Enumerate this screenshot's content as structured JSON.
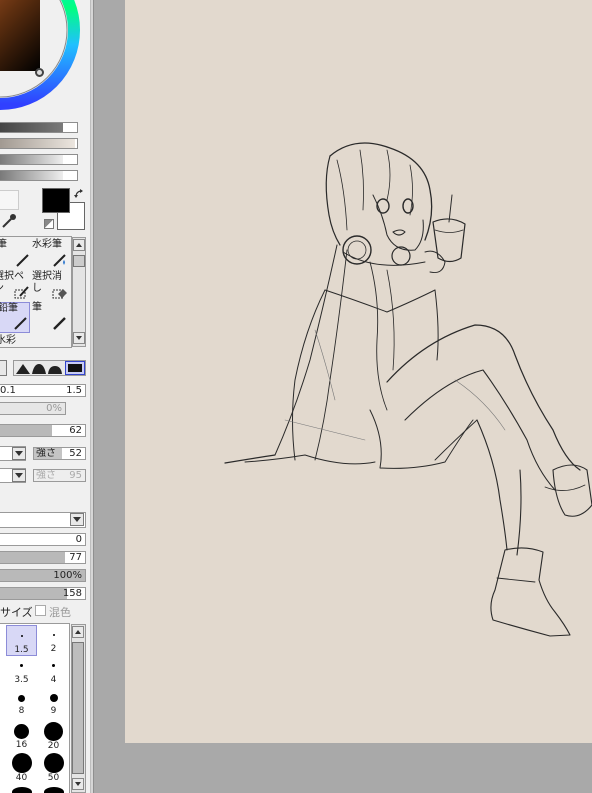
{
  "colors": {
    "panel_bg": "#f0f0f0",
    "canvas_bg": "#e2d9ce",
    "workspace_bg": "#a9a9a9",
    "primary_color": "#000000",
    "secondary_color": "#ffffff",
    "selection_highlight": "#d8d8f6"
  },
  "tools": {
    "items": [
      {
        "label": "筆",
        "icon": "pen-icon"
      },
      {
        "label": "水彩筆",
        "icon": "watercolor-brush-icon"
      },
      {
        "label": "選択ペン",
        "icon": "selection-pen-icon"
      },
      {
        "label": "選択消し",
        "icon": "selection-eraser-icon"
      },
      {
        "label": "鉛筆",
        "icon": "pencil-icon",
        "selected": true
      },
      {
        "label": "筆",
        "icon": "brush-icon"
      },
      {
        "label": "水彩",
        "icon": ""
      }
    ]
  },
  "brush_settings": {
    "size_multiplier": "1.5",
    "size_prefix": "0.1",
    "min_size": "0%",
    "density": "62",
    "blend_label": "強さ",
    "blend_value": "52",
    "texture_label": "強さ",
    "texture_value": "95",
    "mix": "0",
    "water": "77",
    "color_extension": "100%",
    "persistence": "158",
    "size_label": "サイズ",
    "mix_checkbox_label": "混色",
    "levels": {
      "density": 0.62,
      "water": 0.77,
      "extension": 1.0,
      "persistence": 0.79
    }
  },
  "brush_sizes": [
    {
      "label": "1.5",
      "selected": true
    },
    {
      "label": "2"
    },
    {
      "label": "3.5"
    },
    {
      "label": "4"
    },
    {
      "label": "8"
    },
    {
      "label": "9"
    },
    {
      "label": "16"
    },
    {
      "label": "20"
    },
    {
      "label": "40"
    },
    {
      "label": "50"
    }
  ]
}
